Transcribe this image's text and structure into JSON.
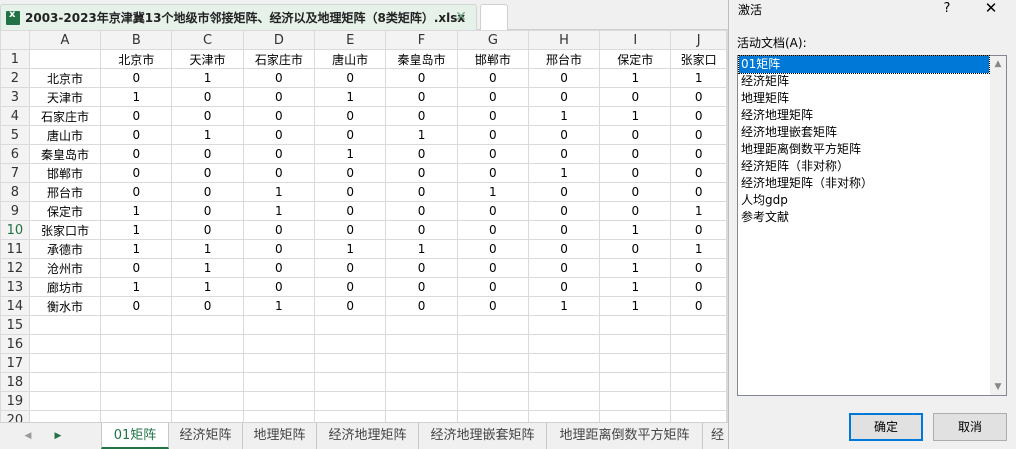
{
  "window": {
    "file_title": "2003-2023年京津冀13个地级市邻接矩阵、经济以及地理矩阵（8类矩阵）.xlsx",
    "close_glyph": "✕"
  },
  "sheet": {
    "column_headers": [
      "A",
      "B",
      "C",
      "D",
      "E",
      "F",
      "G",
      "H",
      "I",
      "J"
    ],
    "row_numbers": [
      "1",
      "2",
      "3",
      "4",
      "5",
      "6",
      "7",
      "8",
      "9",
      "10",
      "11",
      "12",
      "13",
      "14",
      "15",
      "16",
      "17",
      "18",
      "19",
      "20"
    ],
    "header_row": [
      "",
      "北京市",
      "天津市",
      "石家庄市",
      "唐山市",
      "秦皇岛市",
      "邯郸市",
      "邢台市",
      "保定市",
      "张家口"
    ],
    "rows": [
      {
        "name": "北京市",
        "values": [
          "0",
          "1",
          "0",
          "0",
          "0",
          "0",
          "0",
          "1",
          "1"
        ]
      },
      {
        "name": "天津市",
        "values": [
          "1",
          "0",
          "0",
          "1",
          "0",
          "0",
          "0",
          "0",
          "0"
        ]
      },
      {
        "name": "石家庄市",
        "values": [
          "0",
          "0",
          "0",
          "0",
          "0",
          "0",
          "1",
          "1",
          "0"
        ]
      },
      {
        "name": "唐山市",
        "values": [
          "0",
          "1",
          "0",
          "0",
          "1",
          "0",
          "0",
          "0",
          "0"
        ]
      },
      {
        "name": "秦皇岛市",
        "values": [
          "0",
          "0",
          "0",
          "1",
          "0",
          "0",
          "0",
          "0",
          "0"
        ]
      },
      {
        "name": "邯郸市",
        "values": [
          "0",
          "0",
          "0",
          "0",
          "0",
          "0",
          "1",
          "0",
          "0"
        ]
      },
      {
        "name": "邢台市",
        "values": [
          "0",
          "0",
          "1",
          "0",
          "0",
          "1",
          "0",
          "0",
          "0"
        ]
      },
      {
        "name": "保定市",
        "values": [
          "1",
          "0",
          "1",
          "0",
          "0",
          "0",
          "0",
          "0",
          "1"
        ]
      },
      {
        "name": "张家口市",
        "values": [
          "1",
          "0",
          "0",
          "0",
          "0",
          "0",
          "0",
          "1",
          "0"
        ]
      },
      {
        "name": "承德市",
        "values": [
          "1",
          "1",
          "0",
          "1",
          "1",
          "0",
          "0",
          "0",
          "1"
        ]
      },
      {
        "name": "沧州市",
        "values": [
          "0",
          "1",
          "0",
          "0",
          "0",
          "0",
          "0",
          "1",
          "0"
        ]
      },
      {
        "name": "廊坊市",
        "values": [
          "1",
          "1",
          "0",
          "0",
          "0",
          "0",
          "0",
          "1",
          "0"
        ]
      },
      {
        "name": "衡水市",
        "values": [
          "0",
          "0",
          "1",
          "0",
          "0",
          "0",
          "1",
          "1",
          "0"
        ]
      }
    ],
    "selected_row": "10"
  },
  "sheet_tabs": {
    "prev_glyph": "◀",
    "next_glyph": "▶",
    "tabs": [
      "01矩阵",
      "经济矩阵",
      "地理矩阵",
      "经济地理矩阵",
      "经济地理嵌套矩阵",
      "地理距离倒数平方矩阵",
      "经"
    ],
    "active_index": 0
  },
  "dialog": {
    "title": "激活",
    "help_glyph": "?",
    "close_glyph": "✕",
    "doc_label": "活动文档(A):",
    "items": [
      "01矩阵",
      "经济矩阵",
      "地理矩阵",
      "经济地理矩阵",
      "经济地理嵌套矩阵",
      "地理距离倒数平方矩阵",
      "经济矩阵（非对称）",
      "经济地理矩阵（非对称）",
      "人均gdp",
      "参考文献"
    ],
    "selected_index": 0,
    "scroll_up_glyph": "▲",
    "scroll_down_glyph": "▼",
    "ok_label": "确定",
    "cancel_label": "取消"
  },
  "colors": {
    "accent": "#217346",
    "selection": "#0078d7"
  }
}
